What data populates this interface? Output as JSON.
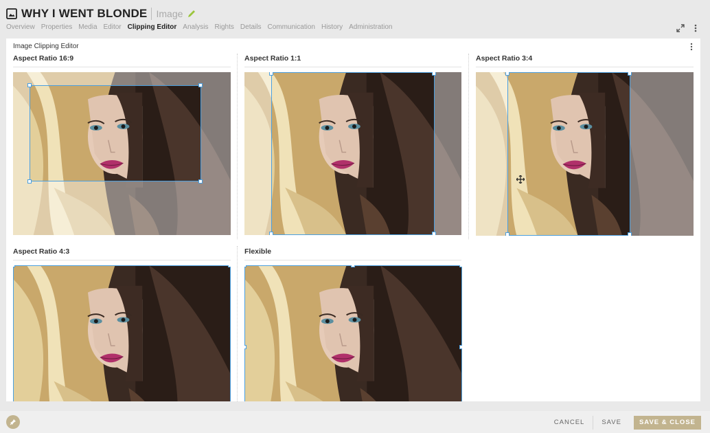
{
  "header": {
    "title": "WHY I WENT BLONDE",
    "type": "Image",
    "icons": {
      "doc": "image-icon",
      "edit": "pencil-icon",
      "expand": "expand-icon",
      "more": "more-vertical-icon"
    }
  },
  "nav": {
    "items": [
      {
        "label": "Overview"
      },
      {
        "label": "Properties"
      },
      {
        "label": "Media"
      },
      {
        "label": "Editor"
      },
      {
        "label": "Clipping Editor",
        "active": true
      },
      {
        "label": "Analysis"
      },
      {
        "label": "Rights"
      },
      {
        "label": "Details"
      },
      {
        "label": "Communication"
      },
      {
        "label": "History"
      },
      {
        "label": "Administration"
      }
    ]
  },
  "panel": {
    "title": "Image Clipping Editor"
  },
  "cells": [
    {
      "label": "Aspect Ratio 16:9"
    },
    {
      "label": "Aspect Ratio 1:1"
    },
    {
      "label": "Aspect Ratio 3:4"
    },
    {
      "label": "Aspect Ratio 4:3"
    },
    {
      "label": "Flexible"
    }
  ],
  "footer": {
    "cancel": "CANCEL",
    "save": "SAVE",
    "save_close": "SAVE & CLOSE"
  },
  "colors": {
    "accent": "#c2b48f",
    "crop_border": "#4a9fe0",
    "edit_icon": "#9bc53d"
  }
}
